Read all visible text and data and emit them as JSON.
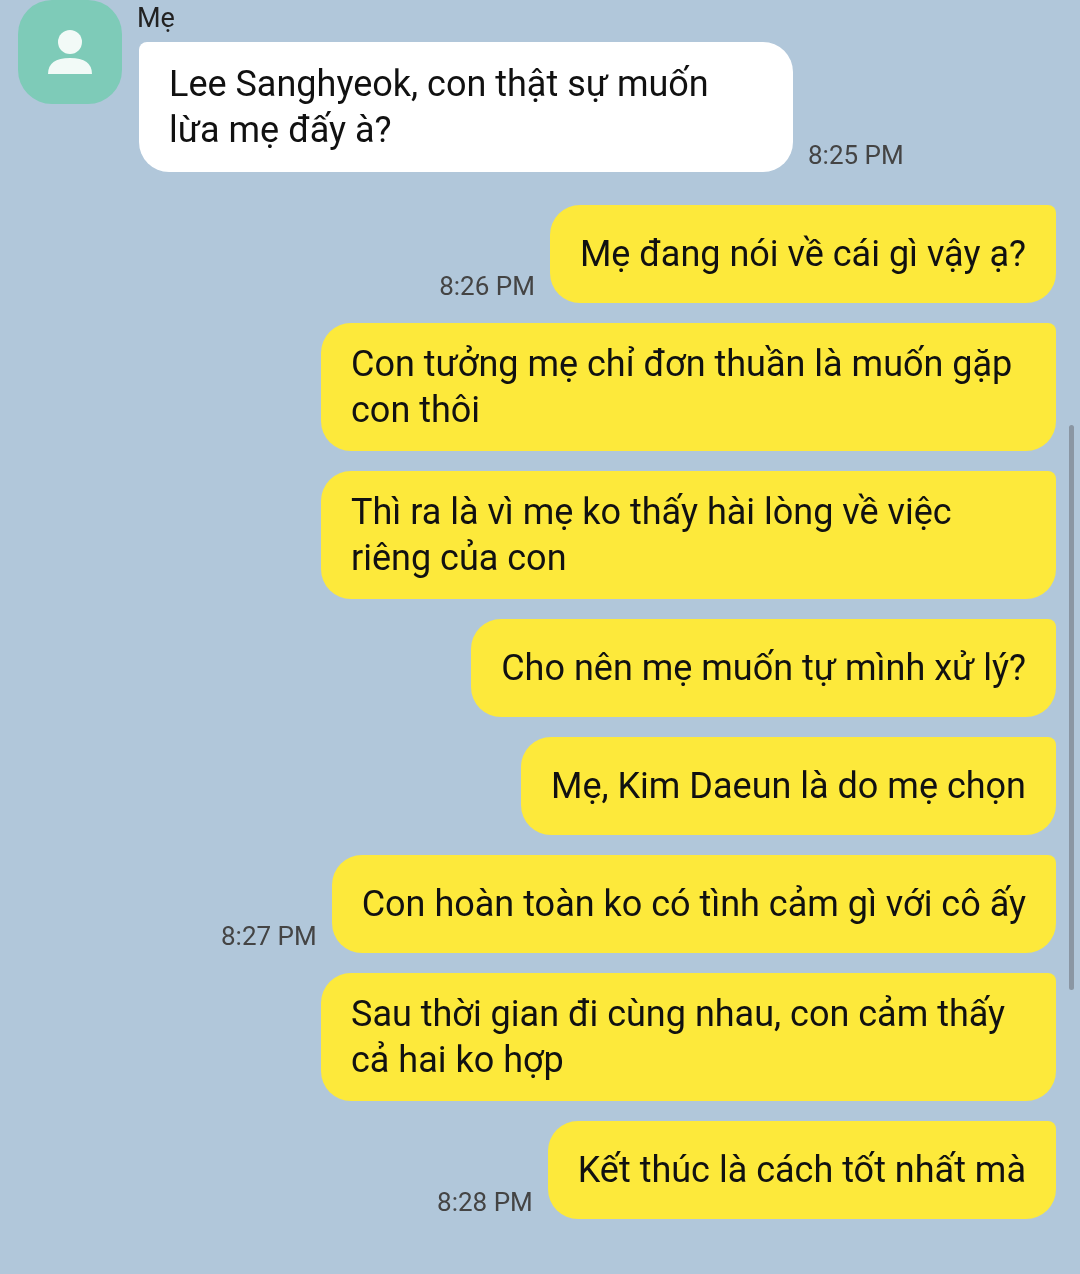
{
  "contact": {
    "name": "Mẹ"
  },
  "messages": [
    {
      "kind": "in",
      "text": "Lee Sanghyeok, con thật sự muốn lừa mẹ đấy à?",
      "time": "8:25 PM"
    },
    {
      "kind": "out",
      "text": "Mẹ đang nói về cái gì vậy ạ?",
      "time": "8:26 PM"
    },
    {
      "kind": "out",
      "text": "Con tưởng mẹ chỉ đơn thuần là muốn gặp con thôi"
    },
    {
      "kind": "out",
      "text": "Thì ra là vì mẹ ko thấy hài lòng về việc riêng của con"
    },
    {
      "kind": "out",
      "text": "Cho nên mẹ muốn tự mình xử lý?"
    },
    {
      "kind": "out",
      "text": "Mẹ, Kim Daeun là do mẹ chọn"
    },
    {
      "kind": "out",
      "text": "Con hoàn toàn ko có tình cảm gì với cô ấy",
      "time": "8:27 PM"
    },
    {
      "kind": "out",
      "text": "Sau thời gian đi cùng nhau, con cảm thấy cả hai ko hợp"
    },
    {
      "kind": "out",
      "text": "Kết thúc là cách tốt nhất mà",
      "time": "8:28 PM"
    }
  ]
}
